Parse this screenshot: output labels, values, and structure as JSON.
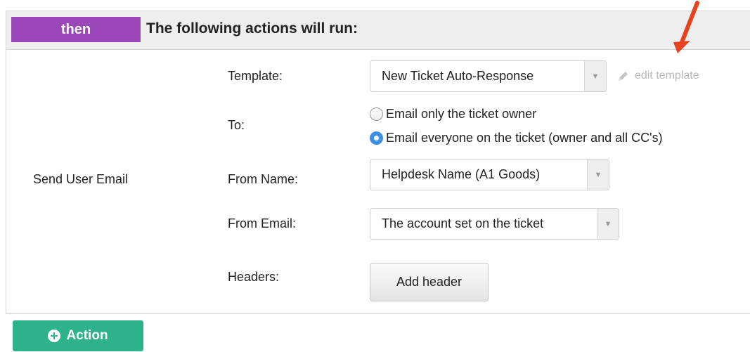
{
  "header": {
    "badge": "then",
    "title": "The following actions will run:"
  },
  "action": {
    "name": "Send User Email",
    "template": {
      "label": "Template:",
      "value": "New Ticket Auto-Response",
      "edit_link": "edit template"
    },
    "to": {
      "label": "To:",
      "options": [
        {
          "label": "Email only the ticket owner",
          "checked": false
        },
        {
          "label": "Email everyone on the ticket (owner and all CC's)",
          "checked": true
        }
      ]
    },
    "from_name": {
      "label": "From Name:",
      "value": "Helpdesk Name (A1 Goods)"
    },
    "from_email": {
      "label": "From Email:",
      "value": "The account set on the ticket"
    },
    "headers": {
      "label": "Headers:",
      "button": "Add header"
    }
  },
  "footer": {
    "add_action_button": "Action"
  },
  "colors": {
    "badge": "#9a47b8",
    "action_button": "#2eb28a",
    "radio_checked": "#3d8ee6",
    "annotation_arrow": "#e8411f"
  },
  "icons": [
    "pencil-icon",
    "caret-down-icon",
    "plus-circle-icon",
    "annotation-arrow"
  ]
}
